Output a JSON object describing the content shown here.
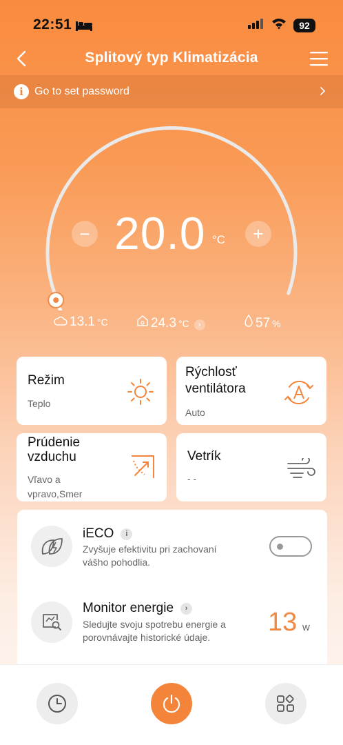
{
  "status_bar": {
    "time": "22:51",
    "battery": "92"
  },
  "header": {
    "title": "Splitový typ Klimatizácia"
  },
  "banner": {
    "text": "Go to set password",
    "info_glyph": "i"
  },
  "thermostat": {
    "setpoint": "20.0",
    "unit": "°C",
    "minus_label": "−",
    "plus_label": "+",
    "dial_level_fraction": 0.1
  },
  "readings": {
    "outdoor_temp": "13.1",
    "outdoor_unit": "°C",
    "indoor_temp": "24.3",
    "indoor_unit": "°C",
    "humidity": "57",
    "humidity_unit": "%"
  },
  "cards": {
    "mode": {
      "title": "Režim",
      "value": "Teplo"
    },
    "fan_speed": {
      "title_line1": "Rýchlosť",
      "title_line2": "ventilátora",
      "value": "Auto"
    },
    "airflow": {
      "title_line1": "Prúdenie",
      "title_line2": "vzduchu",
      "value_line1": "Vľavo a",
      "value_line2": "vpravo,Smer"
    },
    "breeze": {
      "title": "Vetrík",
      "value": "- -"
    }
  },
  "features": {
    "eco": {
      "title": "iECO",
      "info_glyph": "i",
      "desc_line1": "Zvyšuje efektivitu pri zachovaní",
      "desc_line2": "vášho pohodlia.",
      "enabled": false
    },
    "energy": {
      "title": "Monitor energie",
      "desc_line1": "Sledujte svoju spotrebu energie a",
      "desc_line2": "porovnávajte historické údaje.",
      "value": "13",
      "unit": "w"
    }
  },
  "colors": {
    "accent": "#F3843A",
    "text_orange": "#EE8A45"
  }
}
